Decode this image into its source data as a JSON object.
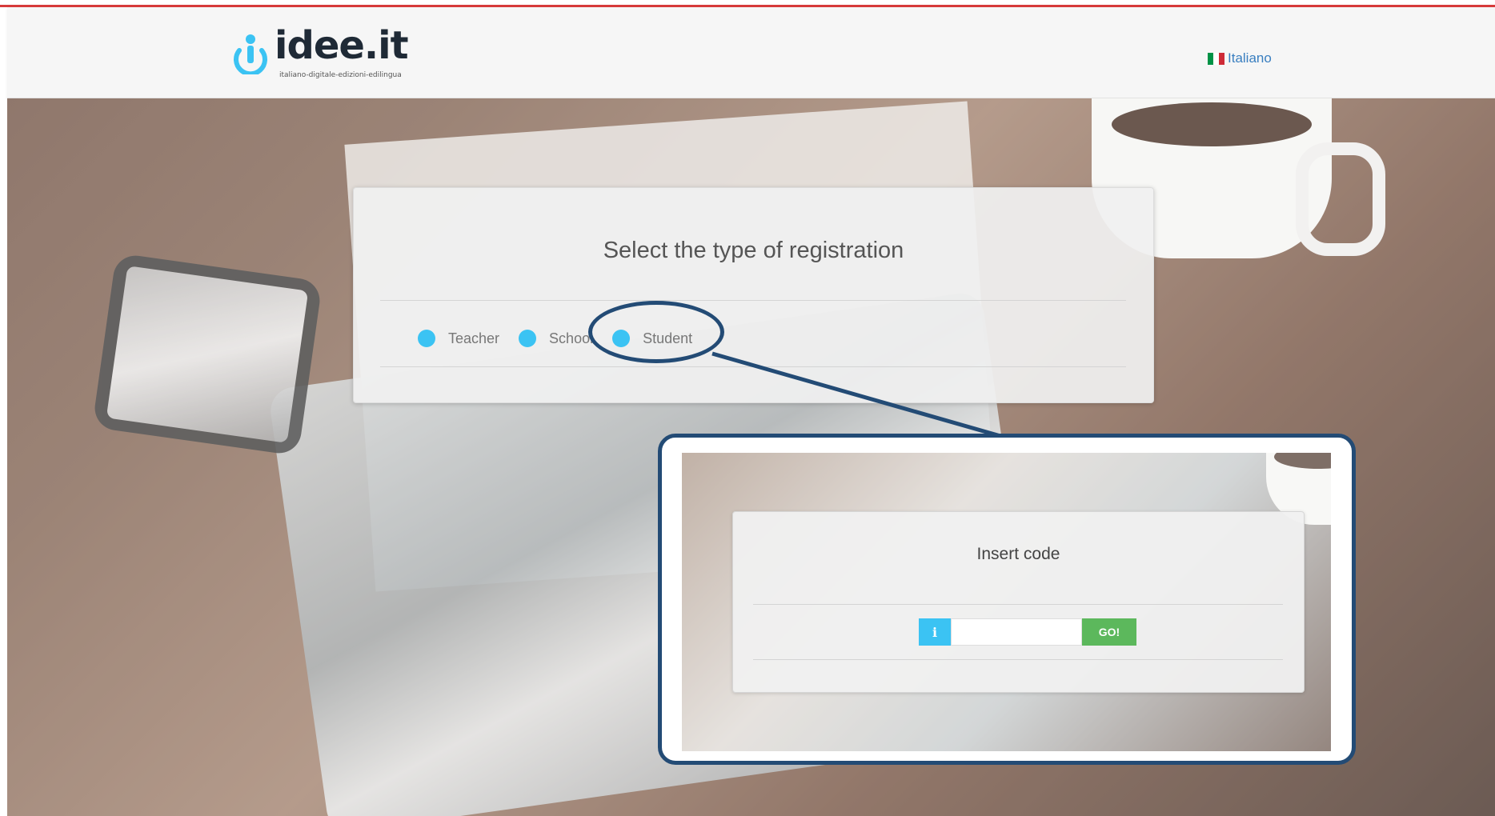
{
  "header": {
    "logo_text": "idee.it",
    "logo_tagline": "italiano-digitale-edizioni-edilingua",
    "language_label": "Italiano",
    "flag_colors": [
      "#009246",
      "#ffffff",
      "#ce2b37"
    ]
  },
  "registration": {
    "title": "Select the type of registration",
    "options": [
      {
        "label": "Teacher"
      },
      {
        "label": "School"
      },
      {
        "label": "Student"
      }
    ]
  },
  "code_panel": {
    "title": "Insert code",
    "info_icon": "i",
    "input_value": "",
    "go_label": "GO!"
  },
  "colors": {
    "accent": "#3bc3f3",
    "go_button": "#5cb85c",
    "callout": "#234b75",
    "top_line": "#d63a3a"
  }
}
